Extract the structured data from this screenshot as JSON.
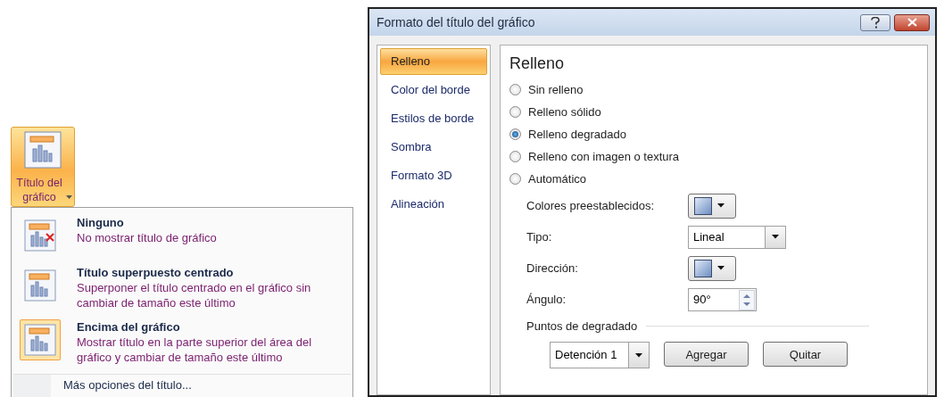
{
  "ribbon_button": {
    "label": "Título del gráfico",
    "selected": true
  },
  "menu": {
    "items": [
      {
        "title": "Ninguno",
        "description": "No mostrar título de gráfico",
        "kind": "none",
        "selected": false
      },
      {
        "title": "Título superpuesto centrado",
        "description": "Superponer el título centrado en el gráfico sin cambiar de tamaño este último",
        "kind": "overlay",
        "selected": false
      },
      {
        "title": "Encima del gráfico",
        "description": "Mostrar título en la parte superior del área del gráfico y cambiar de tamaño este último",
        "kind": "above",
        "selected": true
      }
    ],
    "more_link": "Más opciones del título..."
  },
  "dialog": {
    "title": "Formato del título del gráfico",
    "nav": [
      {
        "label": "Relleno",
        "selected": true
      },
      {
        "label": "Color del borde",
        "selected": false
      },
      {
        "label": "Estilos de borde",
        "selected": false
      },
      {
        "label": "Sombra",
        "selected": false
      },
      {
        "label": "Formato 3D",
        "selected": false
      },
      {
        "label": "Alineación",
        "selected": false
      }
    ],
    "heading": "Relleno",
    "radios": [
      {
        "label": "Sin relleno",
        "selected": false
      },
      {
        "label": "Relleno sólido",
        "selected": false
      },
      {
        "label": "Relleno degradado",
        "selected": true
      },
      {
        "label": "Relleno con imagen o textura",
        "selected": false
      },
      {
        "label": "Automático",
        "selected": false
      }
    ],
    "fields": [
      {
        "kind": "swatch",
        "label": "Colores preestablecidos:"
      },
      {
        "kind": "dropdown",
        "label": "Tipo:",
        "value": "Lineal"
      },
      {
        "kind": "swatch",
        "label": "Dirección:"
      },
      {
        "kind": "spinner",
        "label": "Ángulo:",
        "value": "90°"
      }
    ],
    "stops_section": "Puntos de degradado",
    "stop_dropdown": "Detención 1",
    "buttons": [
      "Agregar",
      "Quitar"
    ]
  }
}
